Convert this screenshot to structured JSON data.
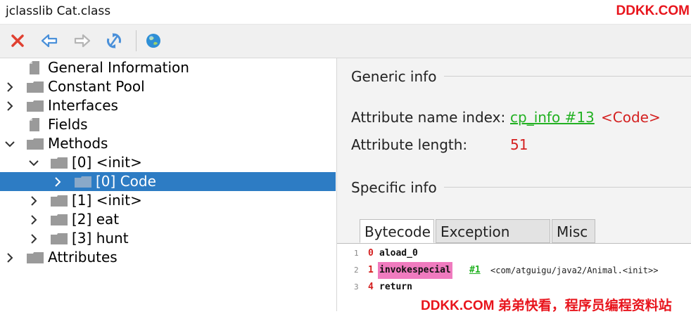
{
  "window": {
    "title": "jclasslib Cat.class"
  },
  "watermark": {
    "top": "DDKK.COM",
    "bottom": "DDKK.COM 弟弟快看，程序员编程资料站",
    "color": "#e8141c"
  },
  "toolbar": {
    "icons": [
      "close-icon",
      "back-arrow-icon",
      "forward-arrow-icon",
      "refresh-icon",
      "globe-icon"
    ]
  },
  "tree": {
    "items": [
      {
        "label": "General Information"
      },
      {
        "label": "Constant Pool"
      },
      {
        "label": "Interfaces"
      },
      {
        "label": "Fields"
      },
      {
        "label": "Methods"
      },
      {
        "label": "[0] <init>"
      },
      {
        "label": "[0] Code"
      },
      {
        "label": "[1] <init>"
      },
      {
        "label": "[2] eat"
      },
      {
        "label": "[3] hunt"
      },
      {
        "label": "Attributes"
      }
    ],
    "selected_color": "#2d7cc4"
  },
  "detail": {
    "generic_info": "Generic info",
    "attr_name_label": "Attribute name index:",
    "attr_name_link": "cp_info #13",
    "attr_name_value": "<Code>",
    "attr_length_label": "Attribute length:",
    "attr_length_value": "51",
    "specific_info": "Specific info",
    "tabs": [
      "Bytecode",
      "Exception table",
      "Misc"
    ],
    "bytecode": [
      {
        "line": "1",
        "offset": "0",
        "op": "aload_0",
        "arg": "",
        "ref": ""
      },
      {
        "line": "2",
        "offset": "1",
        "op": "invokespecial",
        "arg": "#1",
        "ref": "<com/atguigu/java2/Animal.<init>>"
      },
      {
        "line": "3",
        "offset": "4",
        "op": "return",
        "arg": "",
        "ref": ""
      }
    ]
  }
}
